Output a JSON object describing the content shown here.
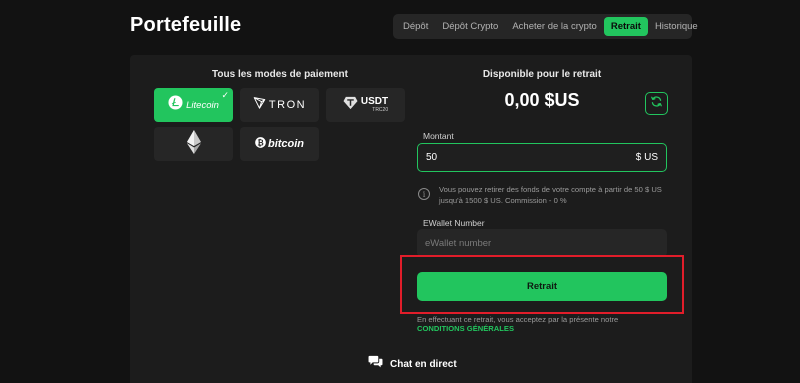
{
  "header": {
    "title": "Portefeuille",
    "tabs": [
      {
        "label": "Dépôt",
        "active": false
      },
      {
        "label": "Dépôt Crypto",
        "active": false
      },
      {
        "label": "Acheter de la crypto",
        "active": false
      },
      {
        "label": "Retrait",
        "active": true
      },
      {
        "label": "Historique",
        "active": false
      }
    ]
  },
  "payment": {
    "title": "Tous les modes de paiement",
    "methods": [
      {
        "label": "Litecoin",
        "icon": "litecoin-icon",
        "selected": true
      },
      {
        "label": "TRON",
        "icon": "tron-icon",
        "selected": false
      },
      {
        "label": "USDT",
        "sublabel": "TRC20",
        "icon": "tether-icon",
        "selected": false
      },
      {
        "label": "",
        "icon": "ethereum-icon",
        "selected": false
      },
      {
        "label": "bitcoin",
        "icon": "bitcoin-icon",
        "selected": false
      }
    ]
  },
  "withdraw": {
    "available_title": "Disponible pour le retrait",
    "balance": "0,00 $US",
    "amount_label": "Montant",
    "amount_value": "50",
    "amount_currency": "$ US",
    "info": "Vous pouvez retirer des fonds de votre compte à partir de 50 $ US jusqu'à 1500 $ US. Commission - 0 %",
    "ewallet_label": "EWallet Number",
    "ewallet_placeholder": "eWallet number",
    "button_label": "Retrait",
    "terms_text": "En effectuant ce retrait, vous acceptez par la présente notre",
    "terms_link": "CONDITIONS GÉNÉRALES"
  },
  "chat": {
    "label": "Chat en direct"
  },
  "colors": {
    "accent": "#22c55e",
    "highlight": "#e11d2a",
    "background": "#121212",
    "panel": "#1c1c1c"
  }
}
